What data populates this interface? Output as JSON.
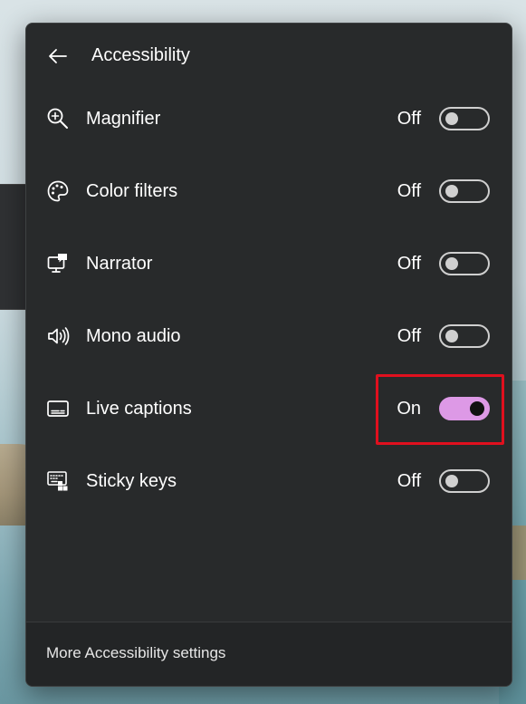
{
  "panel": {
    "title": "Accessibility",
    "back_icon": "back-arrow-icon",
    "items": [
      {
        "label": "Magnifier",
        "state": "Off",
        "on": false,
        "icon": "magnifier-icon"
      },
      {
        "label": "Color filters",
        "state": "Off",
        "on": false,
        "icon": "palette-icon"
      },
      {
        "label": "Narrator",
        "state": "Off",
        "on": false,
        "icon": "narrator-icon"
      },
      {
        "label": "Mono audio",
        "state": "Off",
        "on": false,
        "icon": "speaker-icon"
      },
      {
        "label": "Live captions",
        "state": "On",
        "on": true,
        "icon": "captions-icon"
      },
      {
        "label": "Sticky keys",
        "state": "Off",
        "on": false,
        "icon": "sticky-keys-icon"
      }
    ],
    "footer_link": "More Accessibility settings"
  },
  "colors": {
    "panel_bg": "#282a2b",
    "toggle_on": "#dd99e6",
    "highlight": "#e0101e"
  }
}
